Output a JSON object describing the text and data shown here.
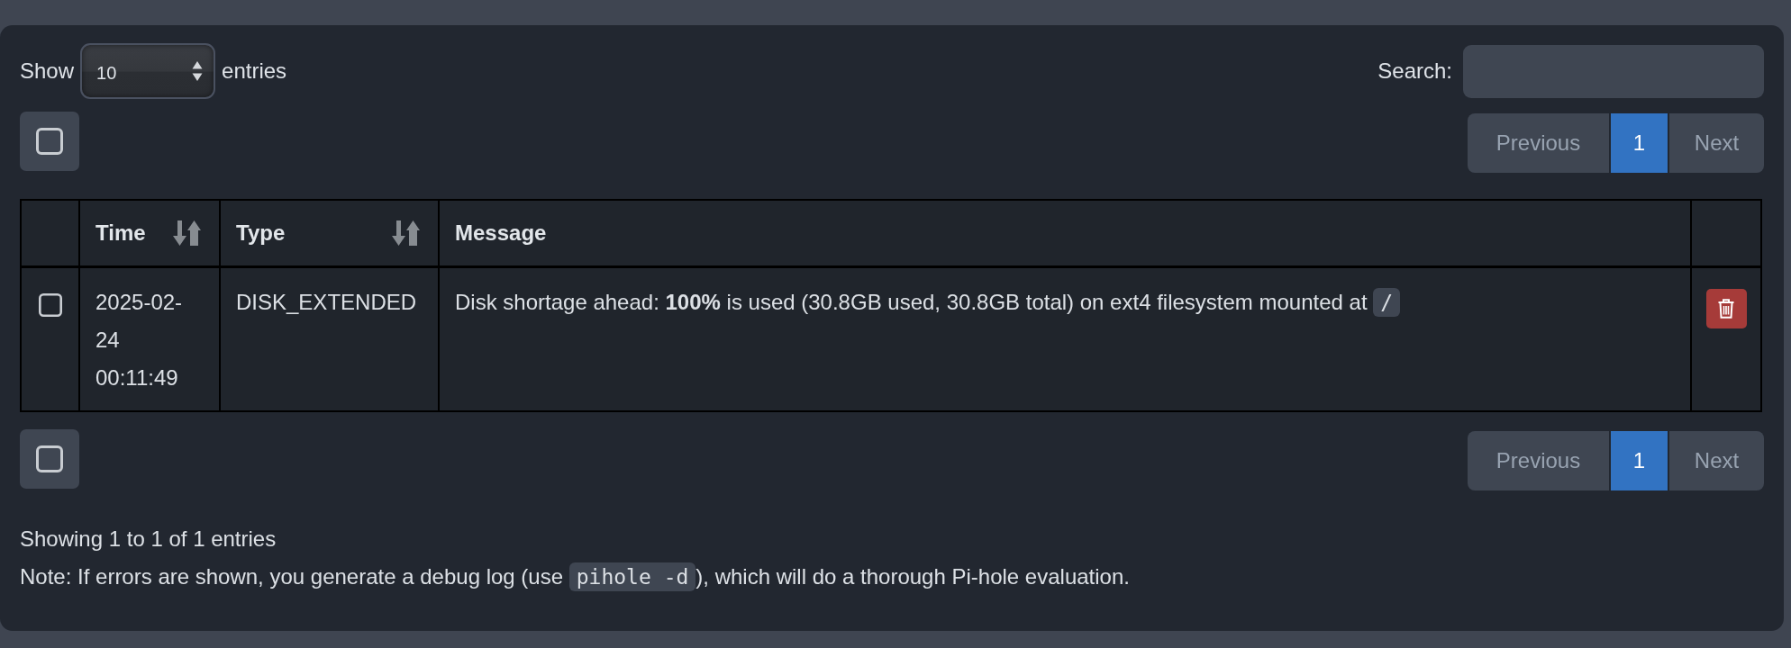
{
  "length_menu": {
    "label": "Show",
    "value": "10",
    "suffix": "entries"
  },
  "search": {
    "label": "Search:"
  },
  "top_controls": {
    "select_all": {
      "checked": false
    },
    "pagination": {
      "previous": {
        "label": "Previous",
        "disabled": true
      },
      "pages": [
        {
          "label": "1",
          "selected": true
        }
      ],
      "next": {
        "label": "Next",
        "disabled": true
      }
    }
  },
  "table": {
    "columns": [
      {
        "label": "Time",
        "sortable": true
      },
      {
        "label": "Type",
        "sortable": true
      },
      {
        "label": "Message",
        "sortable": false
      }
    ],
    "rows": [
      {
        "checked": false,
        "time": "2025-02-24 00:11:49",
        "type": "DISK_EXTENDED",
        "message": [
          {
            "kind": "text",
            "text": "Disk shortage ahead: **100%** is used (30.8GB used, 30.8GB total) on ext4 filesystem mounted at "
          },
          {
            "kind": "code",
            "text": "/"
          }
        ]
      }
    ]
  },
  "bottom_controls": {
    "select_all": {
      "checked": false
    },
    "pagination": {
      "previous": {
        "label": "Previous",
        "disabled": true
      },
      "pages": [
        {
          "label": "1",
          "selected": true
        }
      ],
      "next": {
        "label": "Next",
        "disabled": true
      }
    }
  },
  "info": "Showing 1 to 1 of 1 entries",
  "note": [
    {
      "kind": "text",
      "text": "Note: If errors are shown, you generate a debug log (use "
    },
    {
      "kind": "code",
      "text": "pihole -d"
    },
    {
      "kind": "text",
      "text": "), which will do a thorough Pi-hole evaluation."
    }
  ]
}
